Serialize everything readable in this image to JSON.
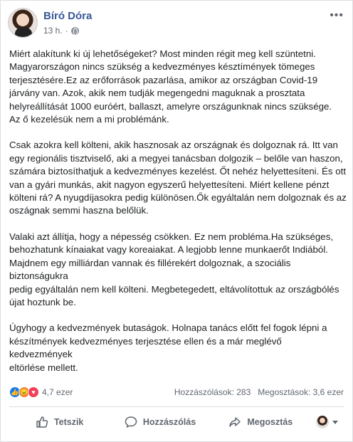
{
  "post": {
    "author": "Bíró Dóra",
    "time": "13 h.",
    "paragraphs": [
      "Miért alakítunk ki új lehetőségeket? Most minden régit meg kell szüntetni.\nMagyarországon nincs szükség a kedvezményes késztímények tömeges\nterjesztésére.Ez az erőforrások pazarlása, amikor az országban Covid-19\njárvány van. Azok, akik nem tudják megengedni maguknak a prosztata\nhelyreállítását 1000 euróért, ballaszt, amelyre országunknak nincs szüksége.\nAz ő kezelésük nem a mi problémánk.",
      "Csak azokra kell költeni, akik hasznosak az országnak és dolgoznak rá. Itt van\negy regionális tisztviselő, aki a megyei tanácsban dolgozik – belőle van haszon,\nszámára biztosíthatjuk a kedvezményes kezelést. Őt nehéz helyettesíteni. És ott\nvan a gyári munkás, akit nagyon egyszerű helyettesíteni. Miért kellene pénzt\nkölteni rá? A nyugdíjasokra pedig különösen.Ők egyáltalán nem dolgoznak és az\noszágnak semmi haszna belőlük.",
      "Valaki azt állítja, hogy a népesség csökken. Ez nem probléma.Ha szükséges,\nbehozhatunk kínaiakat vagy koreaiakat. A legjobb lenne munkaerőt Indiából.\nMajdnem egy milliárdan vannak és fillérekért dolgoznak, a szociális biztonságukra\npedig egyáltalán nem kell költeni. Megbetegedett, eltávolítottuk az országbólés\nújat hoztunk be.",
      "Úgyhogy a kedvezmények butaságok. Holnapa tanács előtt fel fogok lépni a\nkészítmények kedvezményes terjesztése ellen és a már meglévő kedvezmények\neltörlése mellett."
    ],
    "more_icon": "ellipsis-icon",
    "privacy_icon": "globe-icon"
  },
  "stats": {
    "reaction_count": "4,7 ezer",
    "comments": "Hozzászólások: 283",
    "shares": "Megosztások: 3,6 ezer",
    "reaction_icons": [
      "like-icon",
      "angry-icon",
      "love-icon"
    ],
    "colors": {
      "like": "#1877f2",
      "angry": "#f0843a",
      "love": "#f33e58"
    }
  },
  "actions": {
    "like_label": "Tetszik",
    "comment_label": "Hozzászólás",
    "share_label": "Megosztás"
  },
  "colors": {
    "author": "#385898",
    "text": "#1c1e21",
    "muted": "#606770"
  }
}
